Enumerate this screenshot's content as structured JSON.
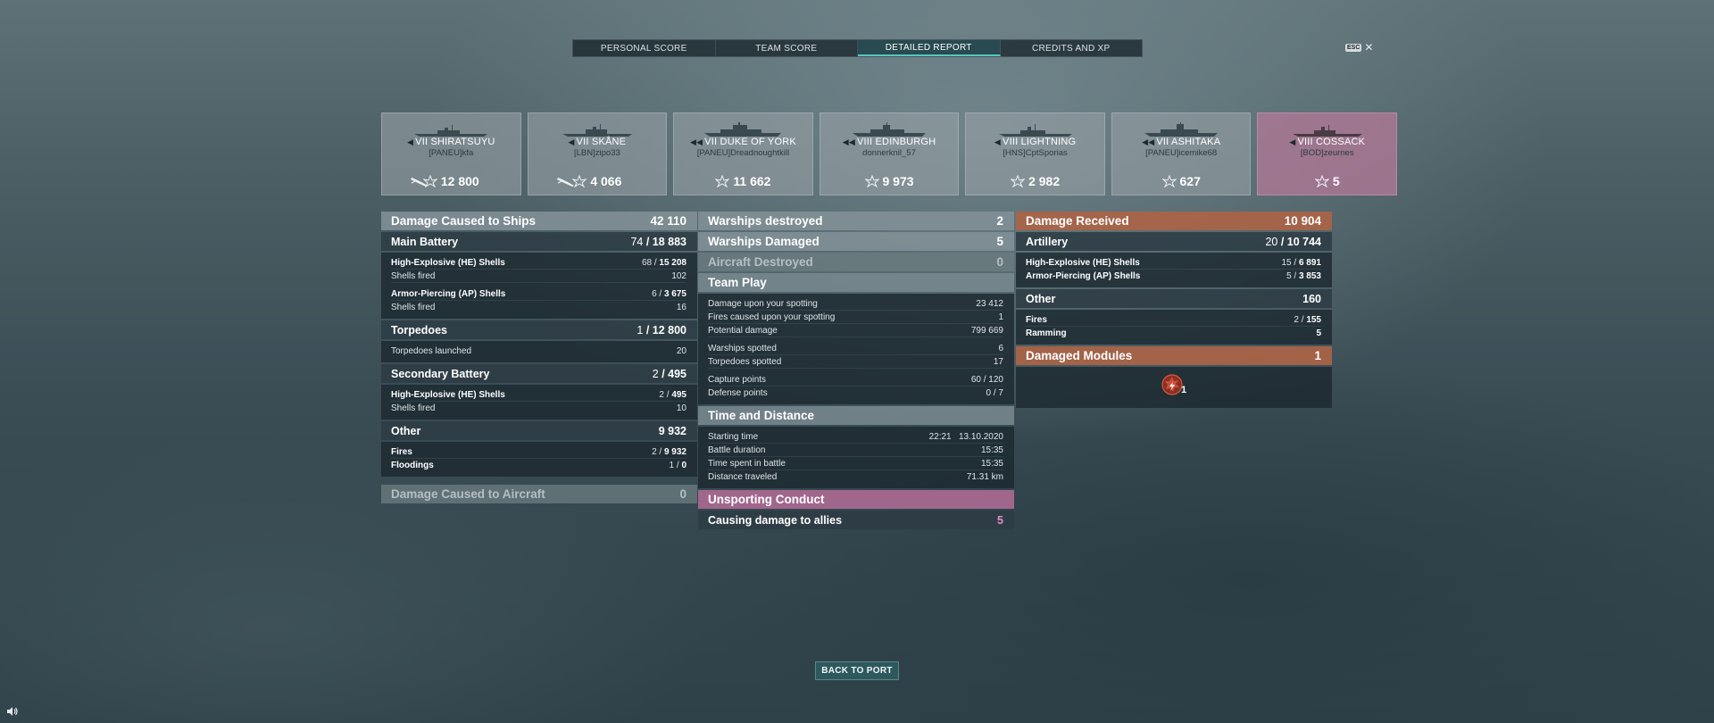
{
  "tabs": [
    {
      "label": "PERSONAL SCORE"
    },
    {
      "label": "TEAM SCORE"
    },
    {
      "label": "DETAILED REPORT"
    },
    {
      "label": "CREDITS AND XP"
    }
  ],
  "esc": {
    "key": "ESC",
    "close": "✕"
  },
  "ships": [
    {
      "name": "VII SHIRATSUYU",
      "player": "[PANEU]kfa",
      "score": "12 800",
      "torp": true
    },
    {
      "name": "VII SKÅNE",
      "player": "[LBN]zipo33",
      "score": "4 066",
      "torp": true
    },
    {
      "name": "VII DUKE OF YORK",
      "player": "[PANEU]Dreadnoughtkill",
      "score": "11 662"
    },
    {
      "name": "VIII EDINBURGH",
      "player": "donnerknil_57",
      "score": "9 973"
    },
    {
      "name": "VIII LIGHTNING",
      "player": "[HNS]CptSporias",
      "score": "2 982"
    },
    {
      "name": "VII ASHITAKA",
      "player": "[PANEU]icemike68",
      "score": "627"
    },
    {
      "name": "VIII COSSACK",
      "player": "[BOD]zeurnes",
      "score": "5",
      "enemy": true
    }
  ],
  "damage": {
    "title": "Damage Caused to Ships",
    "total": "42 110",
    "main_battery": {
      "label": "Main Battery",
      "hits": "74",
      "dmg": "18 883"
    },
    "he": {
      "label": "High-Explosive (HE) Shells",
      "hits": "68",
      "dmg": "15 208"
    },
    "he_fired": {
      "label": "Shells fired",
      "value": "102"
    },
    "ap": {
      "label": "Armor-Piercing (AP) Shells",
      "hits": "6",
      "dmg": "3 675"
    },
    "ap_fired": {
      "label": "Shells fired",
      "value": "16"
    },
    "torpedoes": {
      "label": "Torpedoes",
      "hits": "1",
      "dmg": "12 800"
    },
    "torp_launched": {
      "label": "Torpedoes launched",
      "value": "20"
    },
    "secondary": {
      "label": "Secondary Battery",
      "hits": "2",
      "dmg": "495"
    },
    "sec_he": {
      "label": "High-Explosive (HE) Shells",
      "hits": "2",
      "dmg": "495"
    },
    "sec_fired": {
      "label": "Shells fired",
      "value": "10"
    },
    "other": {
      "label": "Other",
      "dmg": "9 932"
    },
    "fires": {
      "label": "Fires",
      "hits": "2",
      "dmg": "9 932"
    },
    "floodings": {
      "label": "Floodings",
      "hits": "1",
      "dmg": "0"
    },
    "aircraft": {
      "label": "Damage Caused to Aircraft",
      "value": "0"
    }
  },
  "mid": {
    "destroyed": {
      "label": "Warships destroyed",
      "value": "2"
    },
    "damaged": {
      "label": "Warships Damaged",
      "value": "5"
    },
    "aircraft": {
      "label": "Aircraft Destroyed",
      "value": "0"
    },
    "team_play": {
      "title": "Team Play",
      "spot_dmg": {
        "label": "Damage upon your spotting",
        "value": "23 412"
      },
      "spot_fires": {
        "label": "Fires caused upon your spotting",
        "value": "1"
      },
      "potential": {
        "label": "Potential damage",
        "value": "799 669"
      },
      "ships_spotted": {
        "label": "Warships spotted",
        "value": "6"
      },
      "torps_spotted": {
        "label": "Torpedoes spotted",
        "value": "17"
      },
      "capture": {
        "label": "Capture points",
        "value": "60 / 120"
      },
      "defense": {
        "label": "Defense points",
        "value": "0 / 7"
      }
    },
    "time": {
      "title": "Time and Distance",
      "start": {
        "label": "Starting time",
        "value": "22:21   13.10.2020"
      },
      "duration": {
        "label": "Battle duration",
        "value": "15:35"
      },
      "spent": {
        "label": "Time spent in battle",
        "value": "15:35"
      },
      "distance": {
        "label": "Distance traveled",
        "value": "71.31 km"
      }
    },
    "conduct": {
      "title": "Unsporting Conduct",
      "allies": {
        "label": "Causing damage to allies",
        "value": "5"
      }
    }
  },
  "received": {
    "title": "Damage Received",
    "total": "10 904",
    "artillery": {
      "label": "Artillery",
      "hits": "20",
      "dmg": "10 744"
    },
    "he": {
      "label": "High-Explosive (HE) Shells",
      "hits": "15",
      "dmg": "6 891"
    },
    "ap": {
      "label": "Armor-Piercing (AP) Shells",
      "hits": "5",
      "dmg": "3 853"
    },
    "other": {
      "label": "Other",
      "dmg": "160"
    },
    "fires": {
      "label": "Fires",
      "hits": "2",
      "dmg": "155"
    },
    "ramming": {
      "label": "Ramming",
      "dmg": "5"
    },
    "modules": {
      "label": "Damaged Modules",
      "value": "1",
      "icon_count": "1"
    }
  },
  "back_button": "BACK TO PORT",
  "colors": {
    "accent": "#58c7c1",
    "enemy": "#b1789a",
    "received": "#aa6446",
    "conduct": "#aa6991"
  }
}
